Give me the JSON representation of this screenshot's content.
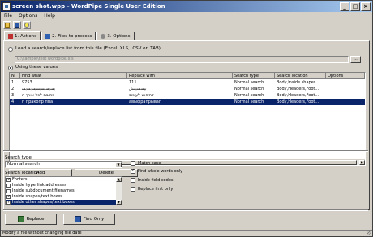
{
  "window": {
    "title": "screen shot.wpp - WordPipe Single User Edition"
  },
  "menu": [
    "File",
    "Options",
    "Help"
  ],
  "tabs": [
    {
      "label": "1. Actions"
    },
    {
      "label": "2. Files to process"
    },
    {
      "label": "3. Options"
    }
  ],
  "source": {
    "load_label": "Load a search/replace list from this file (Excel .XLS, .CSV or .TAB)",
    "file_placeholder": "C:\\sample\\test wordpipe.xls",
    "browse_label": "...",
    "use_values_label": "Using these values"
  },
  "grid": {
    "columns": [
      "N",
      "Find what",
      "Replace with",
      "Search type",
      "Search location",
      "Options"
    ],
    "rows": [
      [
        "1",
        "9753",
        "111",
        "Normal search",
        "Body,Inside shapes...",
        ""
      ],
      [
        "2",
        "ﺑﺴﺑﺴﺑﺴﺑﺴﺑﺴﺑﺴﺑﺴ",
        "ﺑﻴﺴﺴﻴﺴﻞ",
        "Normal search",
        "Body,Headers,Foot...",
        ""
      ],
      [
        "3",
        "כתובת לכל אורך ה",
        "לחיפוש לעיכוב",
        "Normal search",
        "Body,Headers,Foot...",
        ""
      ],
      [
        "4",
        "п пракопр ппа",
        "авыфрапрывап",
        "Normal search",
        "Body,Headers,Foot...",
        ""
      ]
    ]
  },
  "buttons": {
    "add": "Add",
    "delete": "Delete",
    "replace": "Replace",
    "find_only": "Find Only"
  },
  "search_type": {
    "label": "Search type",
    "value": "Normal search"
  },
  "search_location": {
    "label": "Search location",
    "items": [
      {
        "label": "Footers",
        "checked": true
      },
      {
        "label": "Inside hyperlink addresses",
        "checked": false
      },
      {
        "label": "Inside subdocument filenames",
        "checked": false
      },
      {
        "label": "Inside shapes/text boxes",
        "checked": true
      },
      {
        "label": "Inside other shapes/text boxes",
        "checked": true
      }
    ]
  },
  "options": [
    {
      "label": "Match case",
      "checked": false
    },
    {
      "label": "Find whole words only",
      "checked": true
    },
    {
      "label": "Inside field codes",
      "checked": false
    },
    {
      "label": "Replace first only",
      "checked": false
    }
  ],
  "status": "Modify a file without changing file date",
  "colors": {
    "title_start": "#0a246a",
    "title_end": "#a6caf0",
    "face": "#d4d0c8",
    "selection": "#0a246a"
  },
  "icons": [
    "app-icon",
    "open-icon",
    "save-icon",
    "hint-bulb-icon",
    "actions-tab-icon",
    "files-tab-icon",
    "options-tab-icon",
    "replace-icon",
    "find-icon"
  ]
}
